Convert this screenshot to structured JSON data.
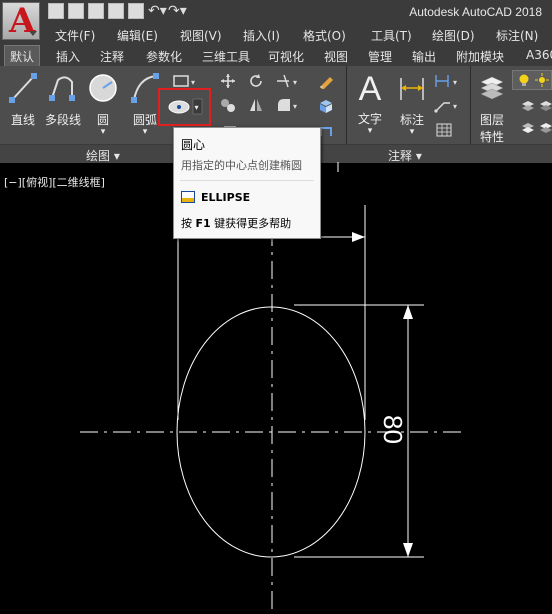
{
  "app": {
    "logo_letter": "A",
    "title": "Autodesk AutoCAD 2018"
  },
  "quick_access": [
    "new-icon",
    "open-icon",
    "save-icon",
    "saveas-icon",
    "print-icon",
    "undo-icon",
    "redo-icon"
  ],
  "menu": [
    "文件(F)",
    "编辑(E)",
    "视图(V)",
    "插入(I)",
    "格式(O)",
    "工具(T)",
    "绘图(D)",
    "标注(N)"
  ],
  "tabs": [
    "默认",
    "插入",
    "注释",
    "参数化",
    "三维工具",
    "可视化",
    "视图",
    "管理",
    "输出",
    "附加模块",
    "A360"
  ],
  "ribbon": {
    "draw_buttons": [
      "直线",
      "多段线",
      "圆",
      "圆弧"
    ],
    "text_button": "文字",
    "dim_button": "标注",
    "layer_button_line1": "图层",
    "layer_button_line2": "特性",
    "panel_draw": "绘图 ▾",
    "panel_annotation": "注释 ▾"
  },
  "viewport": {
    "label": "[−][俯视][二维线框]"
  },
  "tooltip": {
    "title": "圆心",
    "description": "用指定的中心点创建椭圆",
    "command": "ELLIPSE",
    "help_prefix": "按 ",
    "help_key": "F1",
    "help_suffix": " 键获得更多帮助"
  },
  "drawing": {
    "dimension_text": "80"
  },
  "colors": {
    "background": "#000000",
    "ribbon": "#4d4d4d",
    "highlight": "#e02020",
    "logo": "#c8161d"
  }
}
